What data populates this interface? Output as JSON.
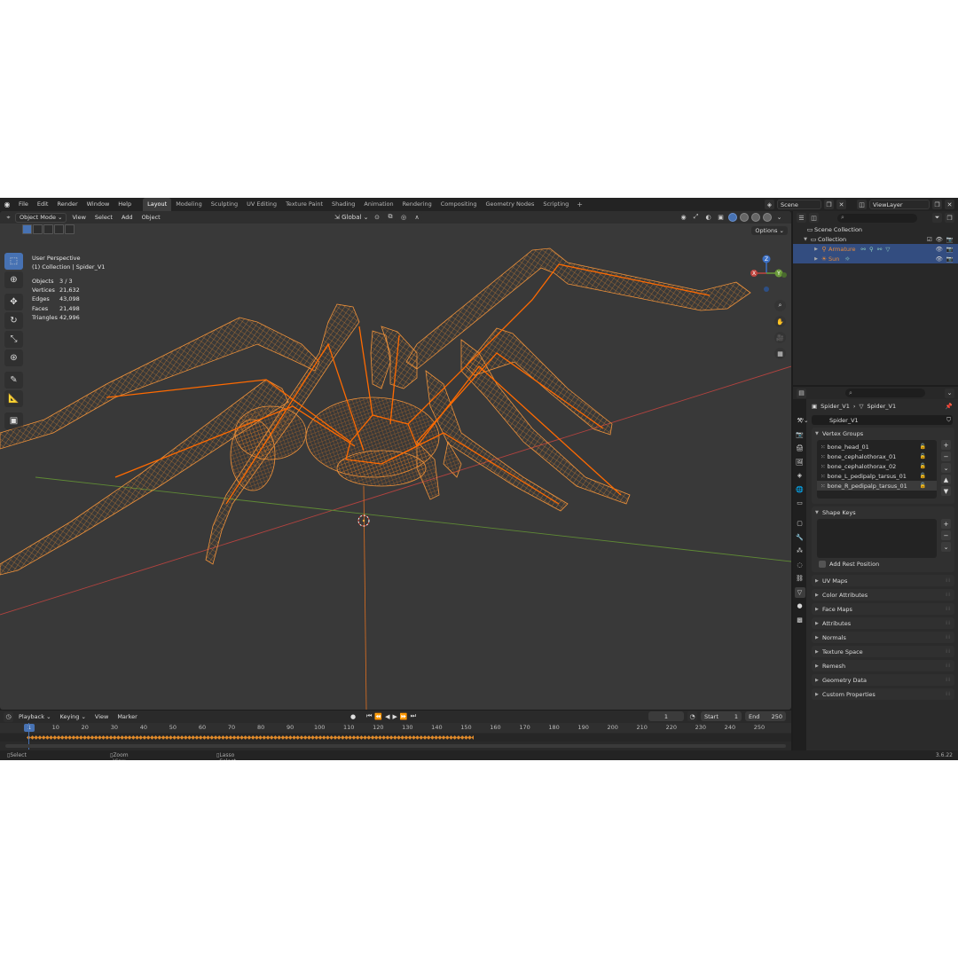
{
  "menu": [
    "File",
    "Edit",
    "Render",
    "Window",
    "Help"
  ],
  "workspaces": [
    "Layout",
    "Modeling",
    "Sculpting",
    "UV Editing",
    "Texture Paint",
    "Shading",
    "Animation",
    "Rendering",
    "Compositing",
    "Geometry Nodes",
    "Scripting"
  ],
  "active_workspace": "Layout",
  "scene": "Scene",
  "view_layer": "ViewLayer",
  "viewport": {
    "mode": "Object Mode",
    "menus": [
      "View",
      "Select",
      "Add",
      "Object"
    ],
    "transform_orientation": "Global",
    "options_label": "Options",
    "perspective": "User Perspective",
    "collection_line": "(1) Collection | Spider_V1",
    "stats": [
      {
        "key": "Objects",
        "value": "3 / 3"
      },
      {
        "key": "Vertices",
        "value": "21,632"
      },
      {
        "key": "Edges",
        "value": "43,098"
      },
      {
        "key": "Faces",
        "value": "21,498"
      },
      {
        "key": "Triangles",
        "value": "42,996"
      }
    ],
    "gizmo_axes": {
      "x": "X",
      "y": "Y",
      "z": "Z"
    },
    "colors": {
      "background": "#393939",
      "wire": "#e8851f",
      "bone": "#ff6a00",
      "x_axis": "#c0453f",
      "y_axis": "#6b9a3a"
    }
  },
  "timeline": {
    "menus": [
      "Playback",
      "Keying",
      "View",
      "Marker"
    ],
    "current_frame": "1",
    "start_label": "Start",
    "start": "1",
    "end_label": "End",
    "end": "250",
    "ticks": [
      "1",
      "10",
      "20",
      "30",
      "40",
      "50",
      "60",
      "70",
      "80",
      "90",
      "100",
      "110",
      "120",
      "130",
      "140",
      "150",
      "160",
      "170",
      "180",
      "190",
      "200",
      "210",
      "220",
      "230",
      "240",
      "250"
    ]
  },
  "status": {
    "select": "Select",
    "zoom": "Zoom View",
    "lasso": "Lasso Select",
    "version": "3.6.22"
  },
  "outliner": {
    "scene_collection": "Scene Collection",
    "collection": "Collection",
    "items": [
      {
        "name": "Armature",
        "icon": "armature-icon"
      },
      {
        "name": "Sun",
        "icon": "light-icon"
      }
    ]
  },
  "properties": {
    "breadcrumb_object": "Spider_V1",
    "breadcrumb_data": "Spider_V1",
    "mesh_name": "Spider_V1",
    "vertex_groups_title": "Vertex Groups",
    "vertex_groups": [
      "bone_head_01",
      "bone_cephalothorax_01",
      "bone_cephalothorax_02",
      "bone_L_pedipalp_tarsus_01",
      "bone_R_pedipalp_tarsus_01"
    ],
    "shape_keys_title": "Shape Keys",
    "add_rest_position": "Add Rest Position",
    "collapsed_panels": [
      "UV Maps",
      "Color Attributes",
      "Face Maps",
      "Attributes",
      "Normals",
      "Texture Space",
      "Remesh",
      "Geometry Data",
      "Custom Properties"
    ]
  }
}
